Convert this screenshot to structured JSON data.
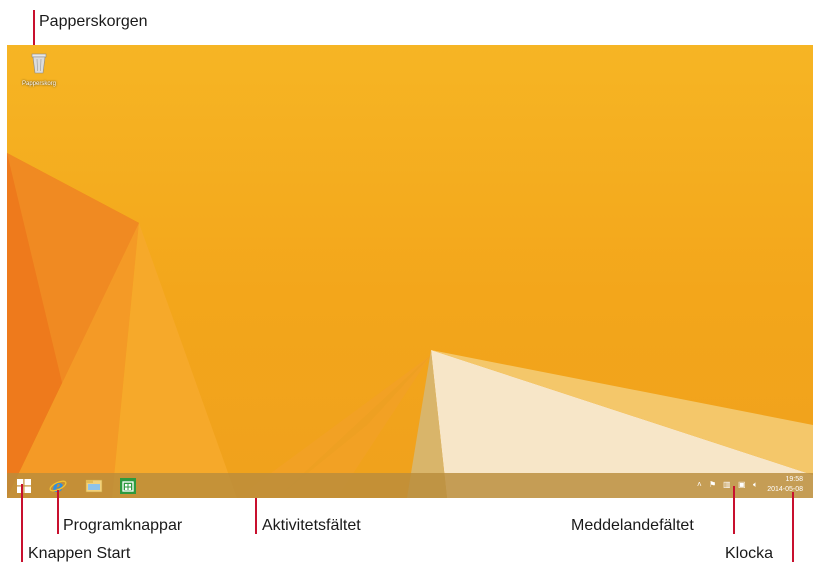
{
  "callouts": {
    "recycle_bin": "Papperskorgen",
    "program_buttons": "Programknappar",
    "start_button": "Knappen Start",
    "taskbar": "Aktivitetsfältet",
    "notification_area": "Meddelandefältet",
    "clock": "Klocka"
  },
  "desktop": {
    "recycle_bin_label": "Papperskorg"
  },
  "taskbar": {
    "pinned": [
      {
        "icon": "internet-explorer-icon"
      },
      {
        "icon": "file-explorer-icon"
      },
      {
        "icon": "store-icon"
      }
    ],
    "clock_time": "19:58",
    "clock_date": "2014-05-08"
  },
  "colors": {
    "wallpaper": "#f5b020",
    "callout_line": "#c8102e"
  }
}
